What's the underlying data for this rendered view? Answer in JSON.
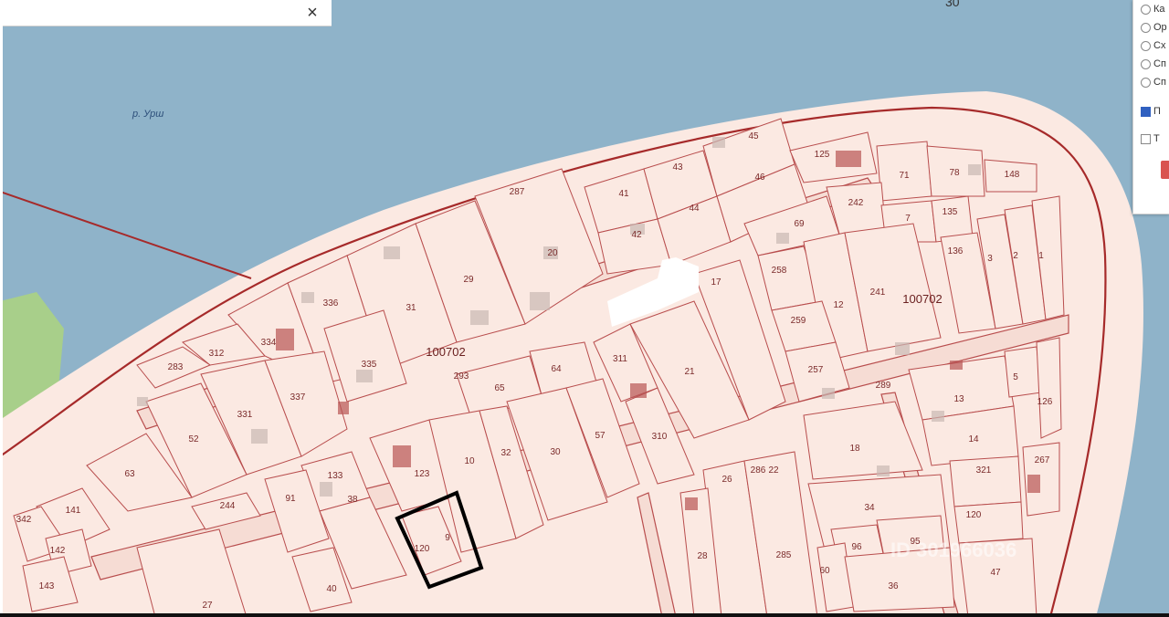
{
  "window": {
    "close_label": "×",
    "top_number": "30"
  },
  "map": {
    "river_label": "р. Урш",
    "quarter_labels": [
      "100702",
      "100702"
    ],
    "highlighted_plot": "9",
    "watermark": "ID 301966036",
    "plots": [
      {
        "id": "45"
      },
      {
        "id": "41"
      },
      {
        "id": "43"
      },
      {
        "id": "46"
      },
      {
        "id": "44"
      },
      {
        "id": "42"
      },
      {
        "id": "125"
      },
      {
        "id": "71"
      },
      {
        "id": "78"
      },
      {
        "id": "148"
      },
      {
        "id": "287"
      },
      {
        "id": "20"
      },
      {
        "id": "29"
      },
      {
        "id": "31"
      },
      {
        "id": "336"
      },
      {
        "id": "334"
      },
      {
        "id": "335"
      },
      {
        "id": "312"
      },
      {
        "id": "283"
      },
      {
        "id": "331"
      },
      {
        "id": "337"
      },
      {
        "id": "52"
      },
      {
        "id": "63"
      },
      {
        "id": "293"
      },
      {
        "id": "65"
      },
      {
        "id": "64"
      },
      {
        "id": "242"
      },
      {
        "id": "69"
      },
      {
        "id": "7"
      },
      {
        "id": "135"
      },
      {
        "id": "136"
      },
      {
        "id": "3"
      },
      {
        "id": "2"
      },
      {
        "id": "1"
      },
      {
        "id": "258"
      },
      {
        "id": "12"
      },
      {
        "id": "241"
      },
      {
        "id": "259"
      },
      {
        "id": "257"
      },
      {
        "id": "17"
      },
      {
        "id": "311"
      },
      {
        "id": "21"
      },
      {
        "id": "310"
      },
      {
        "id": "123"
      },
      {
        "id": "10"
      },
      {
        "id": "32"
      },
      {
        "id": "30"
      },
      {
        "id": "57"
      },
      {
        "id": "133"
      },
      {
        "id": "91"
      },
      {
        "id": "38"
      },
      {
        "id": "40"
      },
      {
        "id": "120"
      },
      {
        "id": "9"
      },
      {
        "id": "141"
      },
      {
        "id": "142"
      },
      {
        "id": "143"
      },
      {
        "id": "342"
      },
      {
        "id": "244"
      },
      {
        "id": "27"
      },
      {
        "id": "289"
      },
      {
        "id": "18"
      },
      {
        "id": "26"
      },
      {
        "id": "286"
      },
      {
        "id": "22"
      },
      {
        "id": "285"
      },
      {
        "id": "28"
      },
      {
        "id": "34"
      },
      {
        "id": "96"
      },
      {
        "id": "95"
      },
      {
        "id": "60"
      },
      {
        "id": "36"
      },
      {
        "id": "13"
      },
      {
        "id": "5"
      },
      {
        "id": "126"
      },
      {
        "id": "14"
      },
      {
        "id": "267"
      },
      {
        "id": "321"
      },
      {
        "id": "120"
      },
      {
        "id": "47"
      }
    ]
  },
  "layer_panel": {
    "items": [
      {
        "type": "radio",
        "label": "Ка"
      },
      {
        "type": "radio",
        "label": "Ор"
      },
      {
        "type": "radio",
        "label": "Сх"
      },
      {
        "type": "radio",
        "label": "Сп"
      },
      {
        "type": "radio",
        "label": "Сп"
      },
      {
        "type": "checkbox",
        "label": "П",
        "checked": true
      },
      {
        "type": "checkbox",
        "label": "Т",
        "checked": false
      }
    ]
  },
  "colors": {
    "water": "#8fb3c9",
    "land": "#fbe9e2",
    "boundary": "#b84d4d",
    "outer_boundary": "#a62a2a",
    "highlight": "#000000"
  }
}
